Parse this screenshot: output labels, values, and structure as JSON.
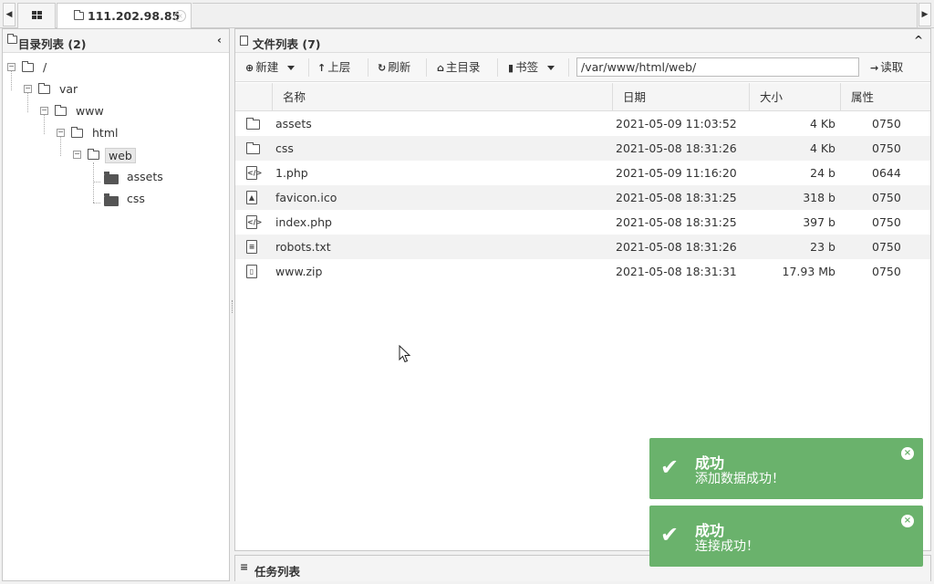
{
  "tabs": {
    "active_title": "111.202.98.85",
    "close_glyph": "×"
  },
  "left_panel": {
    "title": "目录列表 (2)",
    "collapse_glyph": "‹"
  },
  "tree": {
    "nodes": [
      {
        "label": "/"
      },
      {
        "label": "var"
      },
      {
        "label": "www"
      },
      {
        "label": "html"
      },
      {
        "label": "web"
      },
      {
        "label": "assets"
      },
      {
        "label": "css"
      }
    ]
  },
  "right_panel": {
    "title": "文件列表 (7)",
    "collapse_glyph": "^"
  },
  "toolbar": {
    "new_label": "新建",
    "up_label": "上层",
    "refresh_label": "刷新",
    "home_label": "主目录",
    "bookmark_label": "书签",
    "path_value": "/var/www/html/web/",
    "read_label": "读取"
  },
  "columns": {
    "name": "名称",
    "date": "日期",
    "size": "大小",
    "perm": "属性"
  },
  "files": [
    {
      "name": "assets",
      "date": "2021-05-09 11:03:52",
      "size": "4 Kb",
      "perm": "0750",
      "icon": "folder-icon"
    },
    {
      "name": "css",
      "date": "2021-05-08 18:31:26",
      "size": "4 Kb",
      "perm": "0750",
      "icon": "folder-icon"
    },
    {
      "name": "1.php",
      "date": "2021-05-09 11:16:20",
      "size": "24 b",
      "perm": "0644",
      "icon": "code-file-icon"
    },
    {
      "name": "favicon.ico",
      "date": "2021-05-08 18:31:25",
      "size": "318 b",
      "perm": "0750",
      "icon": "image-file-icon"
    },
    {
      "name": "index.php",
      "date": "2021-05-08 18:31:25",
      "size": "397 b",
      "perm": "0750",
      "icon": "code-file-icon"
    },
    {
      "name": "robots.txt",
      "date": "2021-05-08 18:31:26",
      "size": "23 b",
      "perm": "0750",
      "icon": "text-file-icon"
    },
    {
      "name": "www.zip",
      "date": "2021-05-08 18:31:31",
      "size": "17.93 Mb",
      "perm": "0750",
      "icon": "archive-file-icon"
    }
  ],
  "tasks_panel": {
    "title": "任务列表"
  },
  "toasts": [
    {
      "title": "成功",
      "message": "添加数据成功！"
    },
    {
      "title": "成功",
      "message": "连接成功！"
    }
  ],
  "colors": {
    "toast_success": "#6ab26c"
  }
}
